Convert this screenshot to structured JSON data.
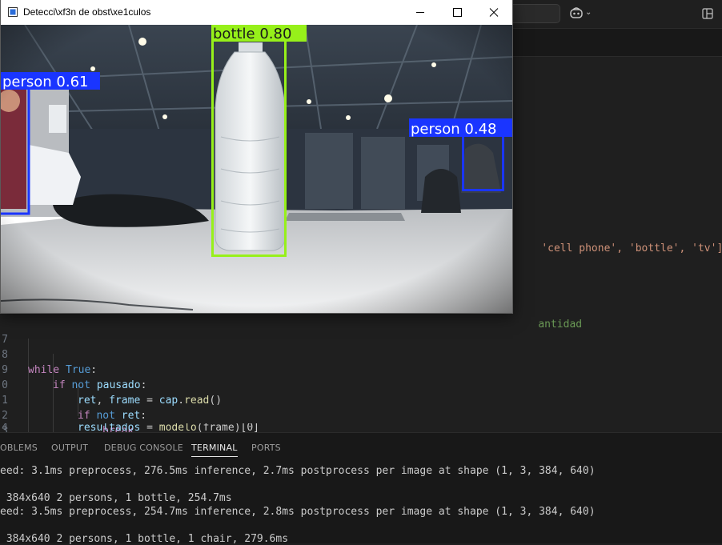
{
  "window": {
    "title": "Detecci\\xf3n de obst\\xe1culos",
    "detections": [
      {
        "label": "person 0.61",
        "color": "#1a35ff"
      },
      {
        "label": "bottle 0.80",
        "color": "#97f01a"
      },
      {
        "label": "person 0.48",
        "color": "#1a35ff"
      }
    ]
  },
  "icons": {
    "copilot": "copilot-icon",
    "chevron": "chevron-down-icon",
    "layout": "layout-icon",
    "minimize": "minimize-icon",
    "maximize": "maximize-icon",
    "close": "close-icon"
  },
  "editor": {
    "class_list_fragment": "'cell phone', 'bottle', 'tv']",
    "comment_fragment": "antidad",
    "line_numbers": [
      "7",
      "8",
      "9",
      "0",
      "1",
      "2",
      "3",
      "4"
    ],
    "code": {
      "while_kw": "while",
      "true_kw": "True",
      "colon": ":",
      "if_kw": "if",
      "not_kw": "not",
      "pausado": "pausado",
      "ret": "ret",
      "comma": ", ",
      "frame": "frame",
      "assign": " = ",
      "cap": "cap",
      "read": "read",
      "read_call": "()",
      "break_kw": "break",
      "resultados": "resultados",
      "modelo": "modelo",
      "modelo_call": "(frame)[0]",
      "dot": "."
    }
  },
  "panel": {
    "tabs": [
      "OBLEMS",
      "OUTPUT",
      "DEBUG CONSOLE",
      "TERMINAL",
      "PORTS"
    ],
    "active_tab": "TERMINAL",
    "terminal_lines": [
      "eed: 3.1ms preprocess, 276.5ms inference, 2.7ms postprocess per image at shape (1, 3, 384, 640)",
      " 384x640 2 persons, 1 bottle, 254.7ms",
      "eed: 3.5ms preprocess, 254.7ms inference, 2.8ms postprocess per image at shape (1, 3, 384, 640)",
      " 384x640 2 persons, 1 bottle, 1 chair, 279.6ms"
    ]
  }
}
